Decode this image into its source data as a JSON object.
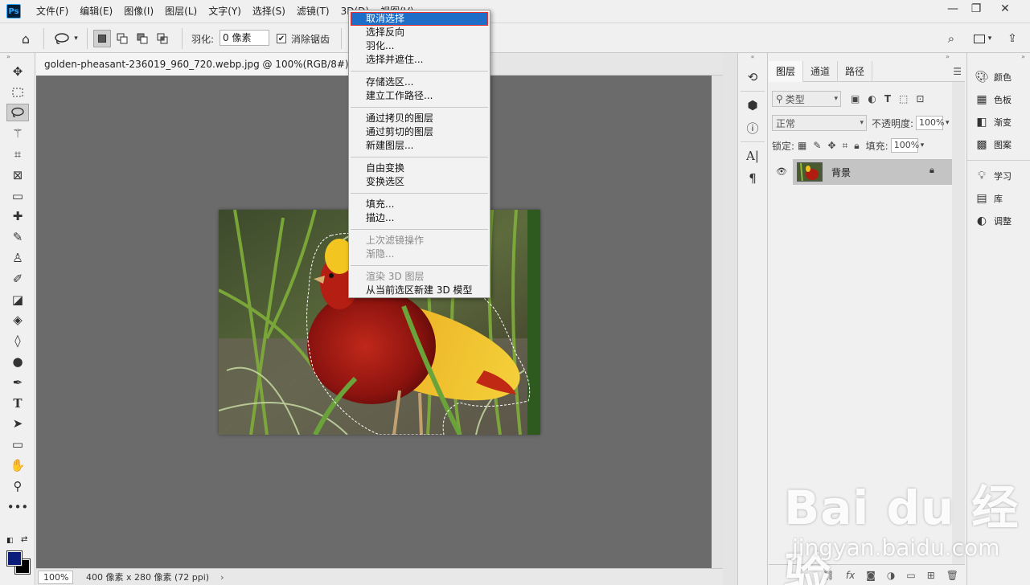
{
  "app": {
    "logo": "Ps"
  },
  "menu": [
    "文件(F)",
    "编辑(E)",
    "图像(I)",
    "图层(L)",
    "文字(Y)",
    "选择(S)",
    "滤镜(T)",
    "3D(D)",
    "视图(V)"
  ],
  "options": {
    "feather_label": "羽化:",
    "feather_value": "0 像素",
    "antialias_label": "消除锯齿",
    "antialias_checked": true
  },
  "document": {
    "tab_title": "golden-pheasant-236019_960_720.webp.jpg @ 100%(RGB/8#)",
    "zoom": "100%",
    "status": "400 像素 x 280 像素 (72 ppi)"
  },
  "context_menu": {
    "groups": [
      [
        {
          "label": "取消选择",
          "highlighted": true
        },
        {
          "label": "选择反向"
        },
        {
          "label": "羽化..."
        },
        {
          "label": "选择并遮住..."
        }
      ],
      [
        {
          "label": "存储选区..."
        },
        {
          "label": "建立工作路径..."
        }
      ],
      [
        {
          "label": "通过拷贝的图层"
        },
        {
          "label": "通过剪切的图层"
        },
        {
          "label": "新建图层..."
        }
      ],
      [
        {
          "label": "自由变换"
        },
        {
          "label": "变换选区"
        }
      ],
      [
        {
          "label": "填充..."
        },
        {
          "label": "描边..."
        }
      ],
      [
        {
          "label": "上次滤镜操作",
          "disabled": true
        },
        {
          "label": "渐隐...",
          "disabled": true
        }
      ],
      [
        {
          "label": "渲染 3D 图层",
          "disabled": true
        },
        {
          "label": "从当前选区新建 3D 模型"
        }
      ]
    ]
  },
  "layers_panel": {
    "tabs": [
      "图层",
      "通道",
      "路径"
    ],
    "filter_kind": "类型",
    "blend_mode": "正常",
    "opacity_label": "不透明度:",
    "opacity_value": "100%",
    "lock_label": "锁定:",
    "fill_label": "填充:",
    "fill_value": "100%",
    "layers": [
      {
        "name": "背景",
        "visible": true,
        "locked": true
      }
    ]
  },
  "right_panel": {
    "items": [
      {
        "label": "颜色",
        "icon": "palette-icon"
      },
      {
        "label": "色板",
        "icon": "swatches-icon"
      },
      {
        "label": "渐变",
        "icon": "gradient-icon"
      },
      {
        "label": "图案",
        "icon": "pattern-icon"
      },
      {
        "label": "学习",
        "icon": "lightbulb-icon"
      },
      {
        "label": "库",
        "icon": "library-icon"
      },
      {
        "label": "调整",
        "icon": "adjust-icon"
      }
    ]
  },
  "watermark": {
    "main": "Bai du 经验",
    "sub": "jingyan.baidu.com"
  },
  "colors": {
    "foreground": "#0b1c7a",
    "background": "#000000",
    "menu_highlight": "#1e6ec8"
  }
}
